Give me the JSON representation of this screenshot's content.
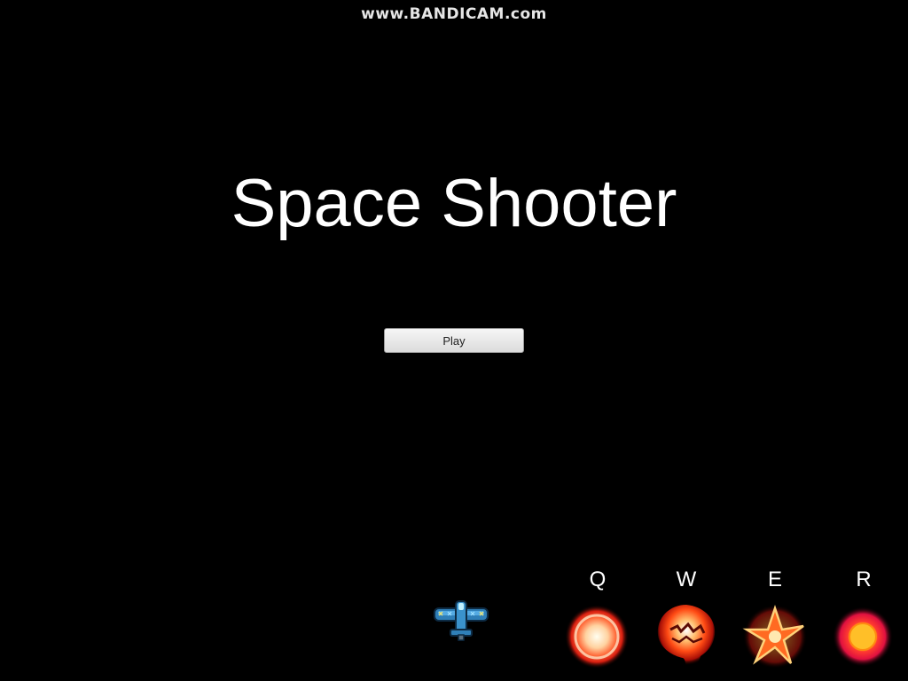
{
  "watermark": "www.BANDICAM.com",
  "game": {
    "title": "Space Shooter",
    "play_label": "Play"
  },
  "abilities": [
    {
      "key": "Q",
      "icon": "fireball-orb-icon",
      "color": "#ff4a2a"
    },
    {
      "key": "W",
      "icon": "fire-burst-icon",
      "color": "#ff3a1a"
    },
    {
      "key": "E",
      "icon": "shuriken-icon",
      "color": "#ff3018"
    },
    {
      "key": "R",
      "icon": "sun-orb-icon",
      "color": "#ff2a3a"
    }
  ],
  "player": {
    "icon": "spaceship-icon"
  }
}
